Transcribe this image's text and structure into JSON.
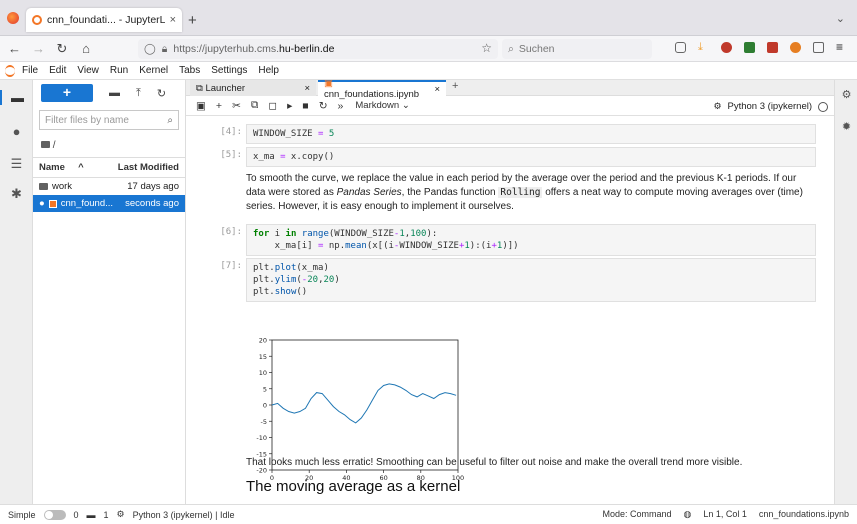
{
  "browser": {
    "tab_title": "cnn_foundati... - JupyterLab",
    "tab_close": "×",
    "new_tab": "+",
    "tab_menu": "⌄",
    "url_prefix": "https://jupyterhub.cms.",
    "url_host": "hu-berlin.de",
    "search_placeholder": "Suchen"
  },
  "jupyter_menu": [
    "File",
    "Edit",
    "View",
    "Run",
    "Kernel",
    "Tabs",
    "Settings",
    "Help"
  ],
  "filebrowser": {
    "filter_placeholder": "Filter files by name",
    "breadcrumb": "/",
    "col_name": "Name",
    "col_modified": "Last Modified",
    "files": [
      {
        "name": "work",
        "modified": "17 days ago",
        "type": "folder"
      },
      {
        "name": "cnn_found...",
        "modified": "seconds ago",
        "type": "notebook"
      }
    ]
  },
  "doc_tabs": {
    "launcher": "Launcher",
    "notebook": "cnn_foundations.ipynb"
  },
  "toolbar": {
    "cell_type": "Markdown",
    "kernel": "Python 3 (ipykernel)"
  },
  "cells": {
    "c1_prompt": "[4]:",
    "c2_prompt": "[5]:",
    "md1_a": "To smooth the curve, we replace the value in each period by the average over the period and the previous K-1 periods. If our data were stored as",
    "md1_em": "Pandas Series",
    "md1_b": ", the Pandas function",
    "md1_code": "Rolling",
    "md1_c": "offers a neat way to compute moving averages over (time) series. However, it is easy enough to implement it ourselves.",
    "c3_prompt": "[6]:",
    "c4_prompt": "[7]:",
    "md2": "That looks much less erratic! Smoothing can be useful to filter out noise and make the overall trend more visible.",
    "h2": "The moving average as a kernel"
  },
  "statusbar": {
    "mode": "Simple",
    "count_a": "0",
    "count_b": "1",
    "kernel_status": "Python 3 (ipykernel) | Idle",
    "command_mode": "Mode: Command",
    "position": "Ln 1, Col 1",
    "file": "cnn_foundations.ipynb"
  },
  "chart_data": {
    "type": "line",
    "xlim": [
      0,
      100
    ],
    "ylim": [
      -20,
      20
    ],
    "xticks": [
      0,
      20,
      40,
      60,
      80,
      100
    ],
    "yticks": [
      -20,
      -15,
      -10,
      -5,
      0,
      5,
      10,
      15,
      20
    ],
    "series": [
      {
        "color": "#1f77b4",
        "x": [
          0,
          3,
          6,
          9,
          12,
          15,
          18,
          21,
          24,
          27,
          30,
          33,
          36,
          39,
          42,
          45,
          48,
          51,
          54,
          57,
          60,
          63,
          66,
          69,
          72,
          75,
          78,
          81,
          84,
          87,
          90,
          93,
          96,
          99
        ],
        "y": [
          0,
          0.5,
          -1,
          -2,
          -2.5,
          -2,
          -1,
          2,
          3.8,
          3.5,
          1.5,
          -0.5,
          -2,
          -3,
          -4.5,
          -5.5,
          -4,
          -1.5,
          1.5,
          4.5,
          6,
          6.5,
          6.2,
          5.5,
          4.5,
          3.2,
          2.5,
          3.5,
          2.8,
          2,
          3.2,
          3.8,
          3.5,
          3
        ]
      }
    ]
  }
}
